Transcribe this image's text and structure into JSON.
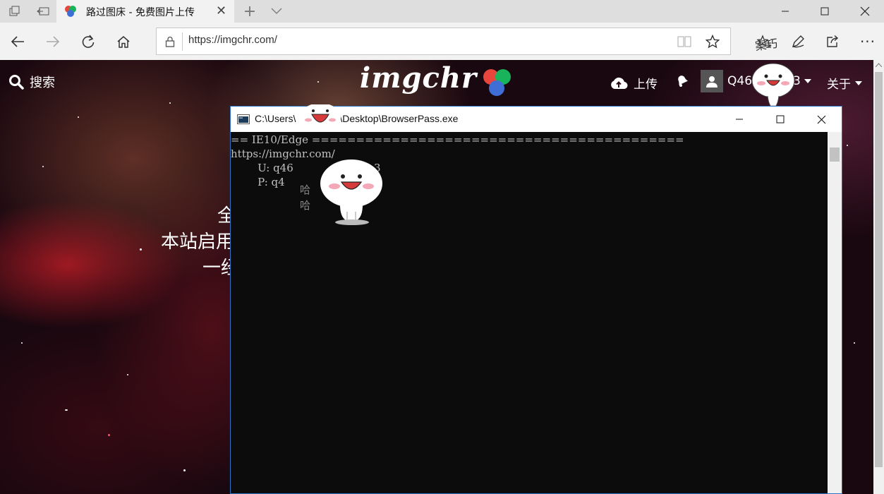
{
  "browser": {
    "tab_title": "路过图床 - 免费图片上传",
    "url": "https://imgchr.com/"
  },
  "site": {
    "search_label": "搜索",
    "logo_text": "imgchr",
    "upload_label": "上传",
    "user_label_prefix": "Q46",
    "user_label_suffix": "3",
    "about_label": "关于",
    "hero_line1": "全",
    "hero_line2": "本站启用",
    "hero_line3": "一经"
  },
  "console": {
    "title_prefix": "C:\\Users\\",
    "title_suffix": "\\Desktop\\BrowserPass.exe",
    "lines": [
      "== IE10/Edge ==========================================",
      "https://imgchr.com/",
      "        U: q46",
      "        P: q4"
    ],
    "u_tail": "3"
  },
  "stickers": {
    "hand_text_top": "案巧",
    "hand_text_mid": "哈",
    "hand_text_low": "哈"
  },
  "colors": {
    "logo_red": "#e8453c",
    "logo_green": "#18b35a",
    "logo_blue": "#3f6fd6",
    "console_bg": "#0c0c0c",
    "console_text": "#c0c0c0"
  }
}
